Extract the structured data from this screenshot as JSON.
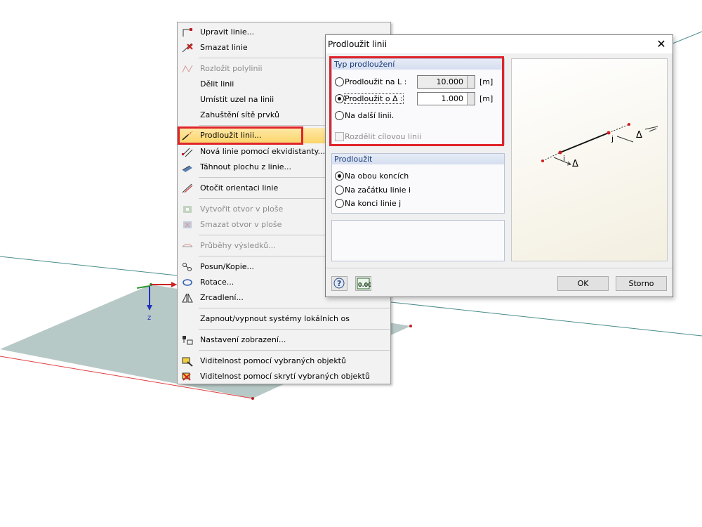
{
  "scene": {
    "axis_label": "z"
  },
  "context_menu": {
    "items": [
      {
        "label": "Upravit linie...",
        "icon": "edit-line-icon",
        "disabled": false
      },
      {
        "label": "Smazat linie",
        "icon": "delete-line-icon",
        "disabled": false
      },
      {
        "label": "Rozložit polylinii",
        "icon": "explode-polyline-icon",
        "disabled": true
      },
      {
        "label": "Dělit linii",
        "icon": "",
        "disabled": false
      },
      {
        "label": "Umístit uzel na linii",
        "icon": "",
        "disabled": false
      },
      {
        "label": "Zahuštění sítě prvků",
        "icon": "",
        "disabled": false
      },
      {
        "label": "Prodloužit linii...",
        "icon": "extend-line-icon",
        "disabled": false,
        "highlighted": true
      },
      {
        "label": "Nová linie pomocí ekvidistanty...",
        "icon": "offset-line-icon",
        "disabled": false
      },
      {
        "label": "Táhnout plochu z linie...",
        "icon": "extrude-surface-icon",
        "disabled": false
      },
      {
        "label": "Otočit orientaci linie",
        "icon": "reverse-line-icon",
        "disabled": false
      },
      {
        "label": "Vytvořit otvor v ploše",
        "icon": "create-opening-icon",
        "disabled": true
      },
      {
        "label": "Smazat otvor v ploše",
        "icon": "delete-opening-icon",
        "disabled": true
      },
      {
        "label": "Průběhy výsledků...",
        "icon": "result-diagram-icon",
        "disabled": true
      },
      {
        "label": "Posun/Kopie...",
        "icon": "move-copy-icon",
        "disabled": false
      },
      {
        "label": "Rotace...",
        "icon": "rotate-icon",
        "disabled": false
      },
      {
        "label": "Zrcadlení...",
        "icon": "mirror-icon",
        "disabled": false
      },
      {
        "label": "Zapnout/vypnout systémy lokálních os",
        "icon": "",
        "disabled": false
      },
      {
        "label": "Nastavení zobrazení...",
        "icon": "display-settings-icon",
        "disabled": false
      },
      {
        "label": "Viditelnost pomocí vybraných objektů",
        "icon": "visibility-selected-icon",
        "disabled": false
      },
      {
        "label": "Viditelnost pomocí skrytí vybraných objektů",
        "icon": "visibility-hide-icon",
        "disabled": false
      }
    ]
  },
  "dialog": {
    "title": "Prodloužit linii",
    "close_label": "✕",
    "type_group": {
      "title": "Typ prodloužení",
      "option1": {
        "label": "Prodloužit na L :",
        "value": "10.000",
        "unit": "[m]",
        "selected": false
      },
      "option2": {
        "label": "Prodloužit o Δ :",
        "value": "1.000",
        "unit": "[m]",
        "selected": true
      },
      "option3": {
        "label": "Na další linii.",
        "selected": false
      },
      "checkbox_label": "Rozdělit cílovou linii"
    },
    "extend_group": {
      "title": "Prodloužit",
      "options": [
        {
          "label": "Na obou koncích",
          "selected": true
        },
        {
          "label": "Na začátku linie i",
          "selected": false
        },
        {
          "label": "Na konci linie j",
          "selected": false
        }
      ]
    },
    "preview": {
      "label_i": "i",
      "label_j": "j",
      "label_delta": "Δ"
    },
    "ok_label": "OK",
    "cancel_label": "Storno",
    "help_icon": "help-icon",
    "units_icon": "units-icon",
    "units_icon_text": "0.00"
  },
  "colors": {
    "highlight_box": "#e0242b",
    "menu_highlight": "#fbd56a",
    "surface": "#b7c9c6"
  }
}
